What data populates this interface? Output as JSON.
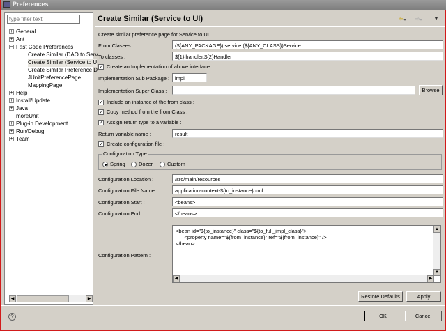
{
  "window": {
    "title": "Preferences"
  },
  "sidebar": {
    "filter_placeholder": "type filter text",
    "items": [
      {
        "label": "General",
        "expander": "+"
      },
      {
        "label": "Ant",
        "expander": "+"
      },
      {
        "label": "Fast Code Preferences",
        "expander": "−"
      },
      {
        "label": "Create Similar (DAO to Serv"
      },
      {
        "label": "Create Similar (Service to U"
      },
      {
        "label": "Create Similar Preference D"
      },
      {
        "label": "JUnitPreferencePage"
      },
      {
        "label": "MappingPage"
      },
      {
        "label": "Help",
        "expander": "+"
      },
      {
        "label": "Install/Update",
        "expander": "+"
      },
      {
        "label": "Java",
        "expander": "+"
      },
      {
        "label": "moreUnit"
      },
      {
        "label": "Plug-in Development",
        "expander": "+"
      },
      {
        "label": "Run/Debug",
        "expander": "+"
      },
      {
        "label": "Team",
        "expander": "+"
      }
    ]
  },
  "page": {
    "title": "Create Similar (Service to UI)",
    "description": "Create similar preference page for Service to UI",
    "from_classes": {
      "label": "From Clasees :",
      "value": "(${ANY_PACKAGE}).service.(${ANY_CLASS})Service"
    },
    "to_classes": {
      "label": "To classes :",
      "value": "${1}.handler.${2}Handler"
    },
    "create_impl": {
      "label": "Create an Implementation of above interface :",
      "checked": true
    },
    "impl_sub_package": {
      "label": "Implementation Sub Package :",
      "value": "impl"
    },
    "impl_super_class": {
      "label": "Implementation Super Class :",
      "value": "",
      "browse": "Browse"
    },
    "include_instance": {
      "label": "Include an instance of the from class :",
      "checked": true
    },
    "copy_method": {
      "label": "Copy method from the from Class :",
      "checked": true
    },
    "assign_return": {
      "label": "Assign return type to a variable :",
      "checked": true
    },
    "return_var": {
      "label": "Return variable name :",
      "value": "result"
    },
    "create_config": {
      "label": "Create configuration file :",
      "checked": true
    },
    "config_type": {
      "label": "Configuration Type",
      "options": [
        "Spring",
        "Dozer",
        "Custom"
      ],
      "selected": "Spring"
    },
    "config_location": {
      "label": "Configuration Location :",
      "value": "/src/main/resources"
    },
    "config_file_name": {
      "label": "Configuration File Name :",
      "value": "application-context-${to_instance}.xml"
    },
    "config_start": {
      "label": "Configuration Start :",
      "value": "<beans>"
    },
    "config_end": {
      "label": "Configuration End :",
      "value": "</beans>"
    },
    "config_pattern": {
      "label": "Configuration Pattern :",
      "value": "<bean id=\"${to_instance}\" class=\"${to_full_impl_class}\">\n      <property name=\"${from_instance}\" ref=\"${from_instance}\" />\n</bean>"
    },
    "restore_defaults": "Restore Defaults",
    "apply": "Apply"
  },
  "footer": {
    "ok": "OK",
    "cancel": "Cancel"
  }
}
